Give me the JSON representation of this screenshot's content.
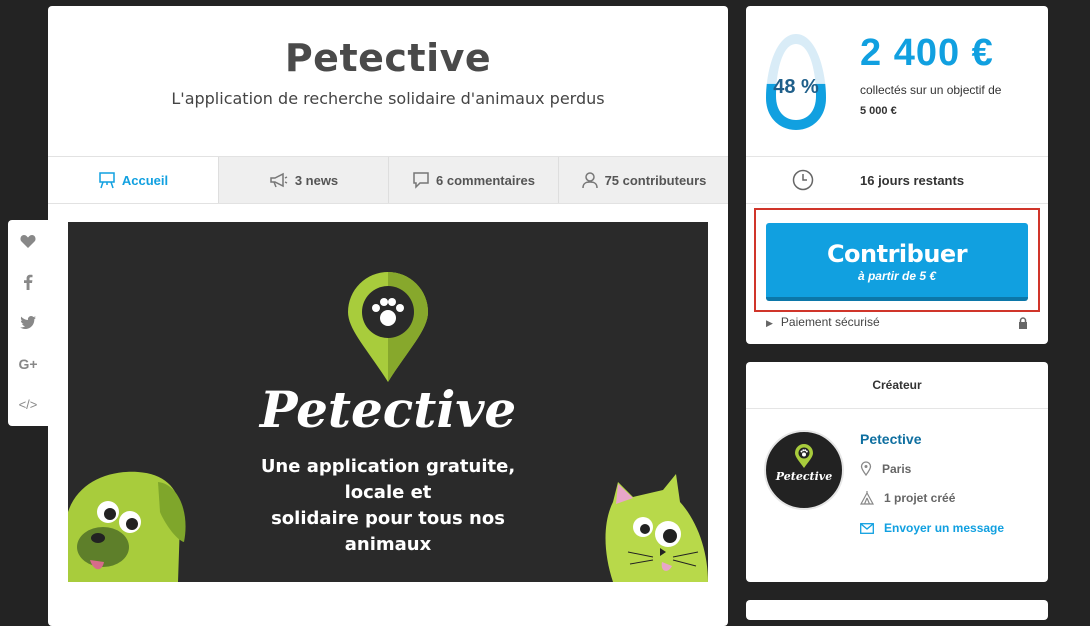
{
  "project": {
    "title": "Petective",
    "subtitle": "L'application de recherche solidaire d'animaux perdus"
  },
  "tabs": [
    {
      "label": "Accueil",
      "icon": "easel-icon",
      "active": true
    },
    {
      "label": "3 news",
      "icon": "megaphone-icon",
      "active": false
    },
    {
      "label": "6 commentaires",
      "icon": "comment-icon",
      "active": false
    },
    {
      "label": "75 contributeurs",
      "icon": "user-icon",
      "active": false
    }
  ],
  "hero": {
    "logo_text": "Petective",
    "tagline_line1": "Une application gratuite, locale et",
    "tagline_line2": "solidaire pour tous nos animaux"
  },
  "share": [
    {
      "icon": "heart-icon"
    },
    {
      "icon": "facebook-icon"
    },
    {
      "icon": "twitter-icon"
    },
    {
      "icon": "google-plus-icon",
      "label": "G+"
    },
    {
      "icon": "embed-code-icon",
      "label": "</>"
    }
  ],
  "funding": {
    "percent_label": "48 %",
    "percent": 48,
    "amount": "2 400 €",
    "goal_text": "collectés sur un objectif de",
    "goal_amount": "5 000 €",
    "days_left": "16 jours restants",
    "cta_label": "Contribuer",
    "cta_sub": "à partir de 5 €",
    "secure_text": "Paiement sécurisé"
  },
  "creator": {
    "header": "Créateur",
    "name": "Petective",
    "avatar_text": "Petective",
    "location": "Paris",
    "projects": "1 projet créé",
    "message_link": "Envoyer un message"
  },
  "colors": {
    "accent": "#11a0e0",
    "accent_dark": "#0c77a9",
    "brand_green": "#a8cc3c",
    "background": "#232323",
    "highlight_border": "#d0352a"
  }
}
